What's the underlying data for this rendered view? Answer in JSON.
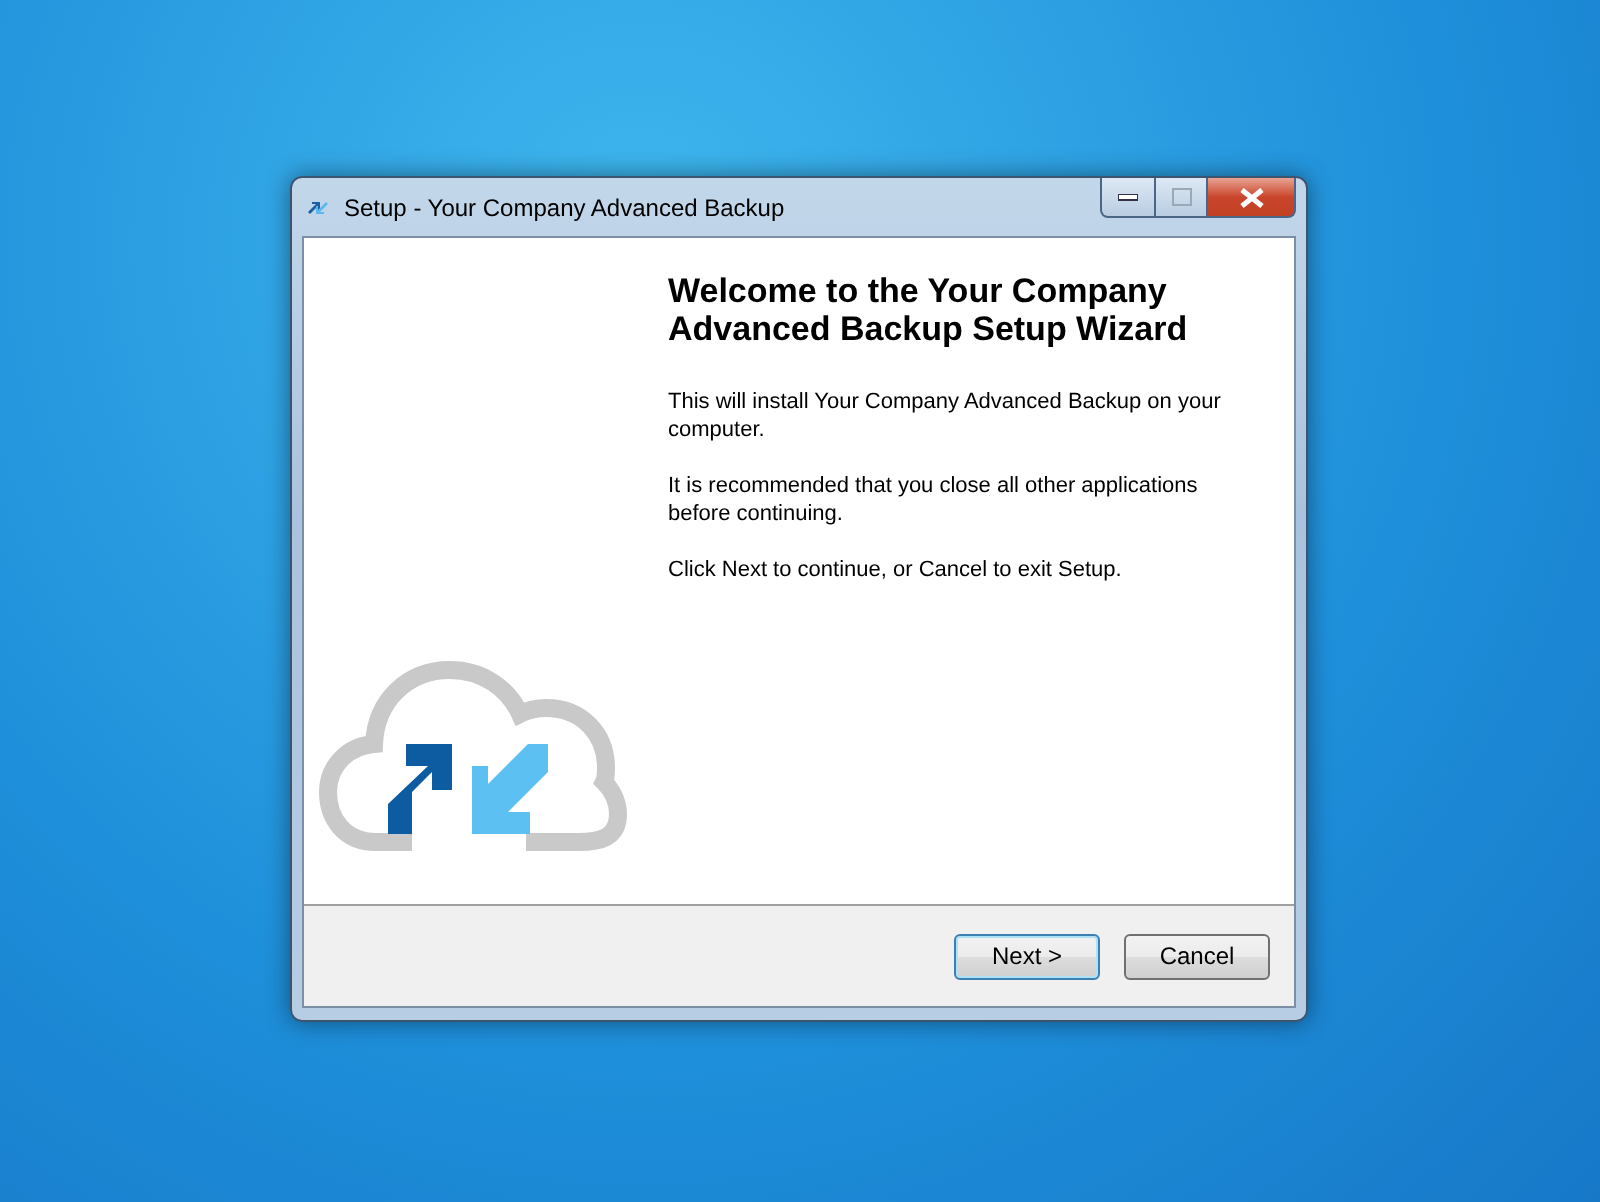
{
  "window": {
    "title": "Setup - Your Company Advanced Backup"
  },
  "heading": "Welcome to the Your Company Advanced Backup Setup Wizard",
  "paragraphs": [
    "This will install Your Company Advanced Backup on your computer.",
    "It is recommended that you close all other applications before continuing.",
    "Click Next to continue, or Cancel to exit Setup."
  ],
  "buttons": [
    {
      "label": "Next >",
      "default": true
    },
    {
      "label": "Cancel",
      "default": false
    }
  ]
}
